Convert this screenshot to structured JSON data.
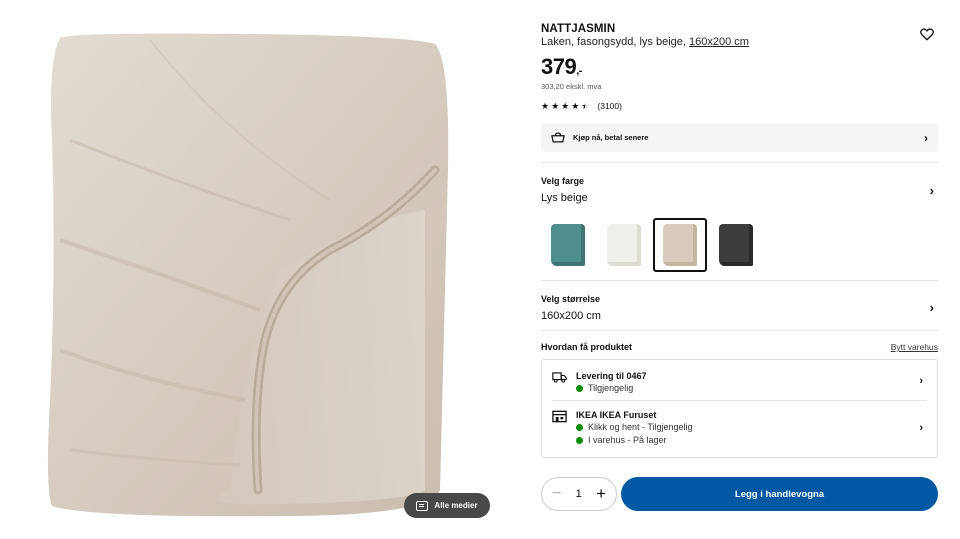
{
  "media": {
    "all_media_label": "Alle medier"
  },
  "product": {
    "name": "NATTJASMIN",
    "description": "Laken, fasongsydd, lys beige,",
    "size_link": "160x200 cm",
    "price": "379",
    "price_suffix": ",-",
    "price_ex_vat": "303,20 ekskl. mva",
    "rating_stars": 4.5,
    "rating_count": "(3100)"
  },
  "finance": {
    "label": "Kjøp nå, betal senere"
  },
  "color": {
    "label": "Velg farge",
    "value": "Lys beige",
    "swatches": [
      {
        "name": "teal",
        "color": "#4f8f90",
        "selected": false
      },
      {
        "name": "white",
        "color": "#f1efe9",
        "selected": false
      },
      {
        "name": "light-beige",
        "color": "#d9cbbb",
        "selected": true
      },
      {
        "name": "dark-grey",
        "color": "#3d3d3d",
        "selected": false
      }
    ]
  },
  "size": {
    "label": "Velg størrelse",
    "value": "160x200 cm"
  },
  "fulfilment": {
    "label": "Hvordan få produktet",
    "change_store": "Bytt varehus",
    "delivery_title": "Levering til 0467",
    "delivery_status": "Tilgjengelig",
    "store_title": "IKEA IKEA Furuset",
    "store_status_1": "Klikk og hent - Tilgjengelig",
    "store_status_2": "I varehus - På lager"
  },
  "cart": {
    "quantity": "1",
    "minus": "−",
    "plus": "+",
    "add_label": "Legg i handlevogna"
  },
  "colors": {
    "primary_blue": "#0058a3",
    "available_green": "#0a8a00",
    "sheet_beige": "#d8cfc3"
  }
}
